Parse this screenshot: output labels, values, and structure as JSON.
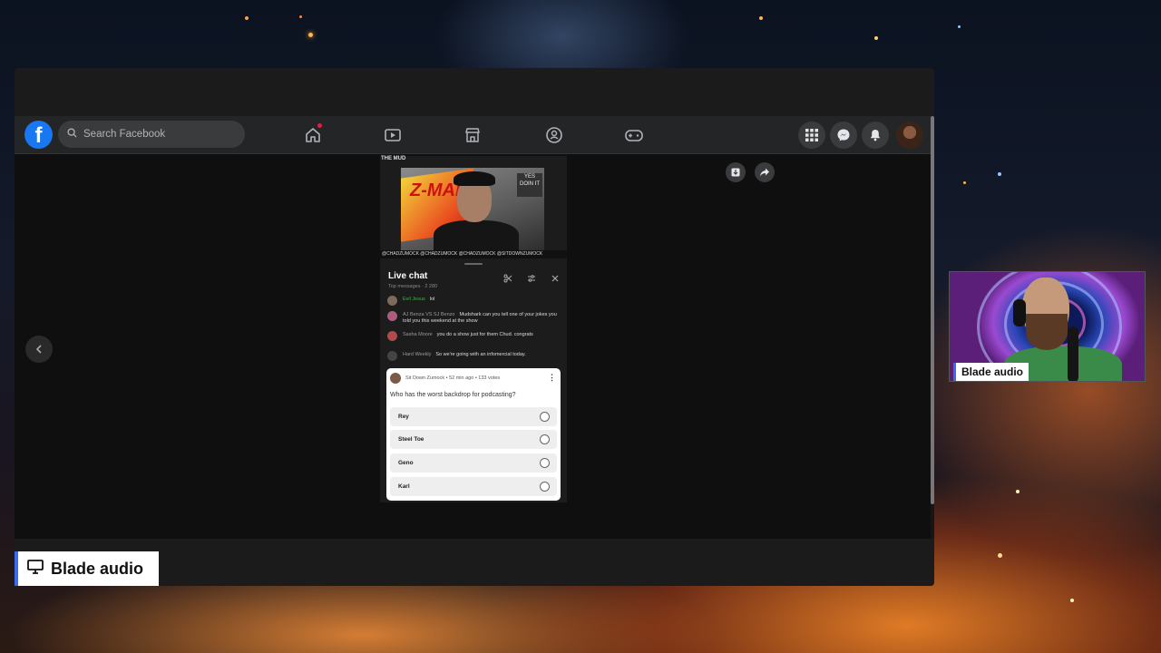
{
  "facebook": {
    "logo": "f",
    "search_placeholder": "Search Facebook",
    "nav_tabs": [
      "home-icon",
      "watch-icon",
      "marketplace-icon",
      "groups-icon",
      "gaming-icon"
    ],
    "right_buttons": [
      "menu-grid-icon",
      "messenger-icon",
      "notifications-icon"
    ]
  },
  "stream": {
    "video_corner_text": "THE MUD",
    "banner_text": "Z-MAN",
    "wall_sign_text": "YES DOIN IT",
    "ticker_text": "@CHADZUMOCK  @CHADZUMOCK  @CHADZUMOCK  @SITDOWNZUMOCK"
  },
  "live_chat": {
    "title": "Live chat",
    "subtitle": "Top messages  · 2 280",
    "messages": [
      {
        "name": "Evil Jesus",
        "text": "lol"
      },
      {
        "name": "AJ Benza VS SJ Benzo",
        "text": "Mudshark can you tell one of your jokes you told you this weekend at the show"
      },
      {
        "name": "Sasha Moore",
        "text": "you do a show just for them Chud. congrats"
      },
      {
        "name": "Hard Weekly",
        "text": "So we're going with an infomercial today."
      }
    ]
  },
  "poll": {
    "meta": "Sit Down Zumock • 52 min ago • 133 votes",
    "question": "Who has the worst backdrop for podcasting?",
    "options": [
      "Rey",
      "Steel Toe",
      "Geno",
      "Karl"
    ]
  },
  "source_label": "Blade audio",
  "webcam_label": "Blade audio",
  "colors": {
    "facebook_blue": "#1877f2",
    "label_accent": "#3b6cf0",
    "notification_dot": "#e41e3f"
  }
}
